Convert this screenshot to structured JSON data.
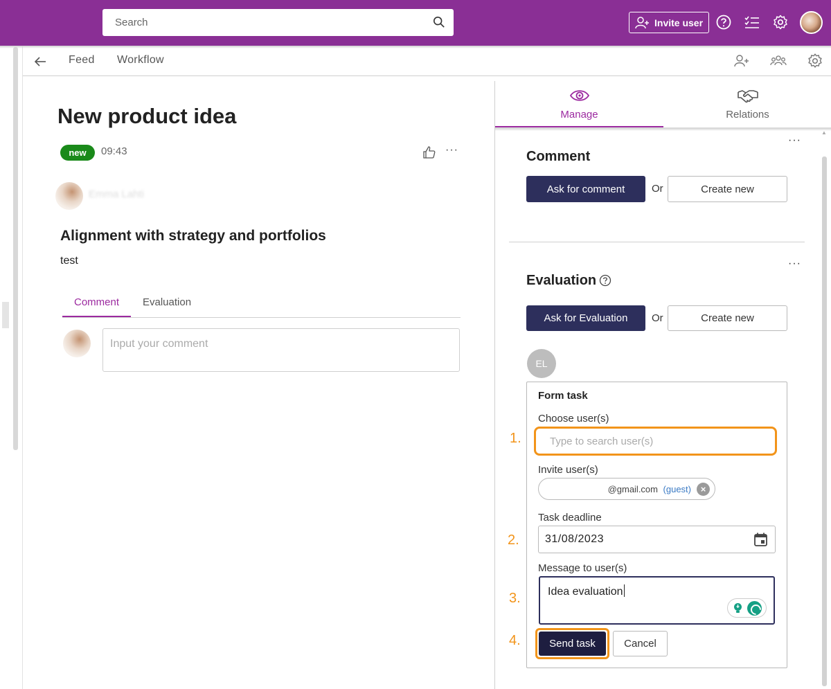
{
  "topbar": {
    "search_placeholder": "Search",
    "invite_label": "Invite user",
    "icons": [
      "search-icon",
      "add-user-icon",
      "help-icon",
      "checklist-icon",
      "settings-icon",
      "avatar"
    ],
    "bg_color": "#8a2f95"
  },
  "subnav": {
    "items": [
      {
        "label": "Feed"
      },
      {
        "label": "Workflow"
      }
    ],
    "icons": [
      "back-arrow-icon",
      "add-user-icon",
      "group-icon",
      "settings-icon"
    ]
  },
  "post": {
    "title": "New product idea",
    "status": "new",
    "time": "09:43",
    "author": "Emma Lahti",
    "section_heading": "Alignment with strategy and portfolios",
    "section_text": "test",
    "tabs": [
      {
        "label": "Comment"
      },
      {
        "label": "Evaluation"
      }
    ],
    "comment_placeholder": "Input your comment"
  },
  "panel": {
    "tabs": [
      {
        "label": "Manage",
        "icon": "eye-icon"
      },
      {
        "label": "Relations",
        "icon": "handshake-icon"
      }
    ],
    "comment": {
      "heading": "Comment",
      "ask_label": "Ask for comment",
      "or_label": "Or",
      "create_label": "Create new"
    },
    "evaluation": {
      "heading": "Evaluation",
      "ask_label": "Ask for Evaluation",
      "or_label": "Or",
      "create_label": "Create new",
      "assignee_initials": "EL"
    },
    "form": {
      "title": "Form task",
      "choose_label": "Choose user(s)",
      "choose_placeholder": "Type to search user(s)",
      "invite_label": "Invite user(s)",
      "invite_email": "@gmail.com",
      "invite_tag": "(guest)",
      "deadline_label": "Task deadline",
      "deadline_value": "31/08/2023",
      "message_label": "Message to user(s)",
      "message_value": "Idea evaluation",
      "send_label": "Send task",
      "cancel_label": "Cancel"
    },
    "steps": [
      "1.",
      "2.",
      "3.",
      "4."
    ],
    "accent_color": "#9c2aa0",
    "highlight_color": "#f2941a",
    "primary_button_color": "#2d2f5c"
  },
  "more_label": "···"
}
